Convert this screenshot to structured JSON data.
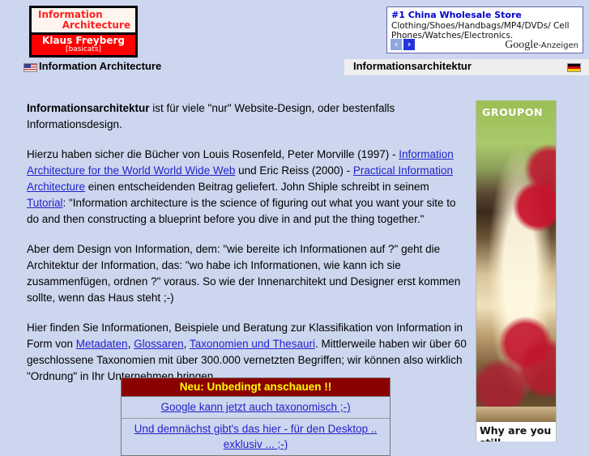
{
  "logo": {
    "line1": "Information",
    "line2": "Architecture",
    "name": "Klaus Freyberg",
    "tagline": "[basicats]"
  },
  "google_ad": {
    "title": "#1 China Wholesale Store",
    "body": "Clothing/Shoes/Handbags/MP4/DVDs/ Cell Phones/Watches/Electronics.",
    "prev_label": "‹",
    "next_label": "›",
    "brand": "Google",
    "brand_suffix": "-Anzeigen"
  },
  "nav": {
    "english_label": "Information Architecture",
    "german_label": "Informationsarchitektur",
    "us_flag_icon": "us-flag-icon",
    "de_flag_icon": "de-flag-icon"
  },
  "content": {
    "p1_lead": "Informationsarchitektur",
    "p1_rest": " ist für viele \"nur\" Website-Design, oder bestenfalls Informationsdesign.",
    "p2_a": "Hierzu haben sicher die Bücher von Louis Rosenfeld, Peter Morville (1997) - ",
    "p2_link1": "Information Architecture for the World World Wide Web",
    "p2_b": " und Eric Reiss (2000) - ",
    "p2_link2": "Practical Information Architecture",
    "p2_c": " einen entscheidenden Beitrag geliefert. John Shiple schreibt in seinem ",
    "p2_link3": "Tutorial",
    "p2_d": ": \"Information architecture is the science of figuring out what you want your site to do and then constructing a blueprint before you dive in and put the thing together.\"",
    "p3": "Aber dem Design von Information, dem: \"wie bereite ich Informationen auf ?\" geht die Architektur der Information, das: \"wo habe ich Informationen, wie kann ich sie zusammenfügen, ordnen ?\" voraus. So wie der Innenarchitekt und Designer erst kommen sollte, wenn das Haus steht ;-)",
    "p4_a": "Hier finden Sie Informationen, Beispiele und Beratung zur Klassifikation von Information in Form von ",
    "p4_link1": "Metadaten",
    "p4_b": ", ",
    "p4_link2": "Glossaren",
    "p4_c": ", ",
    "p4_link3": "Taxonomien und Thesauri",
    "p4_d": ". Mittlerweile haben wir über 60 geschlossene Taxonomien mit über 300.000 vernetzten Begriffen; wir können also wirklich \"Ordnung\" in Ihr Unternehmen bringen."
  },
  "promo": {
    "header": "Neu: Unbedingt anschauen !!",
    "link1": "Google kann jetzt auch taxonomisch ;-)",
    "link2": "Und demnächst gibt's das hier - für den Desktop .. exklusiv ... ;-)"
  },
  "sidebar_ad": {
    "brand": "GROUPON",
    "caption": "Why are you still"
  },
  "colors": {
    "page_background": "#ccd6ee",
    "logo_red": "#ff0000",
    "link_blue": "#2222cc",
    "promo_header_bg": "#8b0000",
    "promo_header_text": "#ffff00",
    "nav_band": "#eeeeee"
  }
}
